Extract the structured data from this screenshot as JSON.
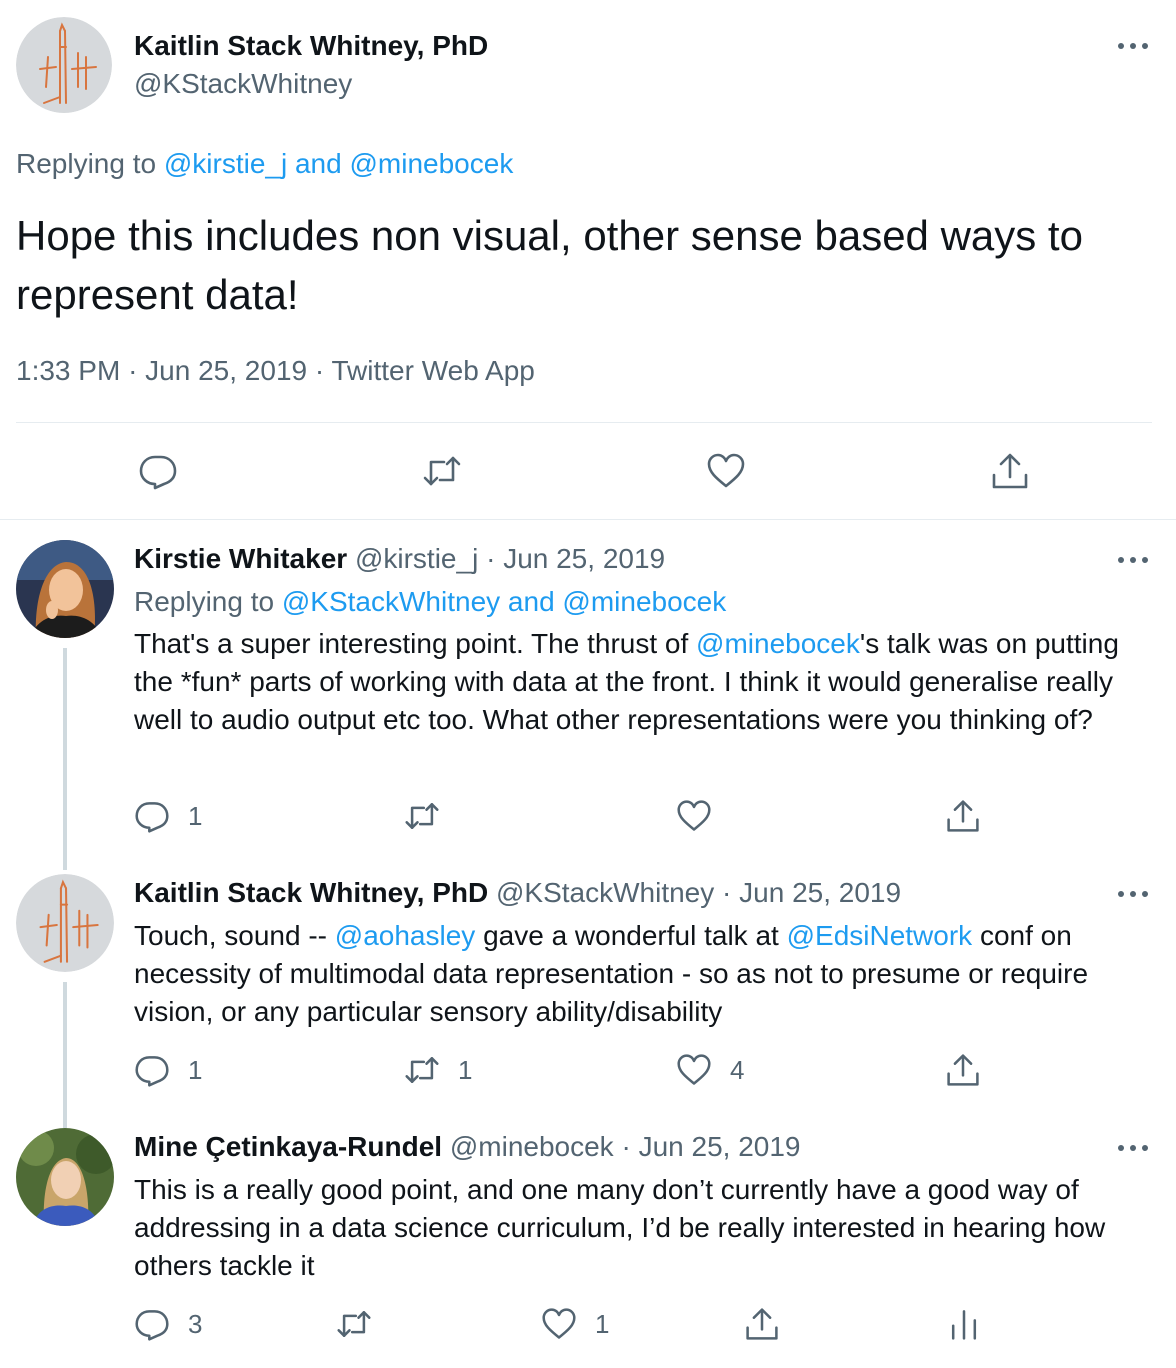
{
  "main_tweet": {
    "author_name": "Kaitlin Stack Whitney, PhD",
    "author_handle": "@KStackWhitney",
    "replying_prefix": "Replying to",
    "replying_users": "@kirstie_j and @minebocek",
    "text": "Hope this includes non visual, other sense based ways to represent data!",
    "time": "1:33 PM",
    "date": "Jun 25, 2019",
    "source": "Twitter Web App",
    "separator": "·"
  },
  "replies": [
    {
      "author_name": "Kirstie Whitaker",
      "author_handle": "@kirstie_j",
      "date": "Jun 25, 2019",
      "replying_prefix": "Replying to",
      "replying_users": "@KStackWhitney and @minebocek",
      "text_parts": [
        "That's a super interesting point. The thrust of ",
        "@minebocek",
        "'s talk was on putting the *fun* parts of working with data at the front. I think it would generalise really well to audio output etc too. What other representations were you thinking of?"
      ],
      "reply_count": "1",
      "retweet_count": "",
      "like_count": ""
    },
    {
      "author_name": "Kaitlin Stack Whitney, PhD",
      "author_handle": "@KStackWhitney",
      "date": "Jun 25, 2019",
      "text_parts": [
        "Touch, sound -- ",
        "@aohasley",
        " gave a wonderful talk at ",
        "@EdsiNetwork",
        " conf on necessity of multimodal data representation - so as not to presume or require vision, or any particular sensory ability/disability"
      ],
      "reply_count": "1",
      "retweet_count": "1",
      "like_count": "4"
    },
    {
      "author_name": "Mine Çetinkaya-Rundel",
      "author_handle": "@minebocek",
      "date": "Jun 25, 2019",
      "text_parts": [
        "This is a really good point, and one many don’t currently have a good way of addressing in a data science curriculum, I’d be really interested in hearing how others tackle it"
      ],
      "reply_count": "3",
      "retweet_count": "",
      "like_count": "1"
    }
  ],
  "icons": {
    "more": "more-icon",
    "reply": "reply-icon",
    "retweet": "retweet-icon",
    "like": "like-icon",
    "share": "share-icon",
    "analytics": "analytics-icon"
  },
  "colors": {
    "link": "#1d9bf0",
    "muted": "#536471",
    "text": "#0f1419",
    "thread_line": "#cfd9de"
  }
}
